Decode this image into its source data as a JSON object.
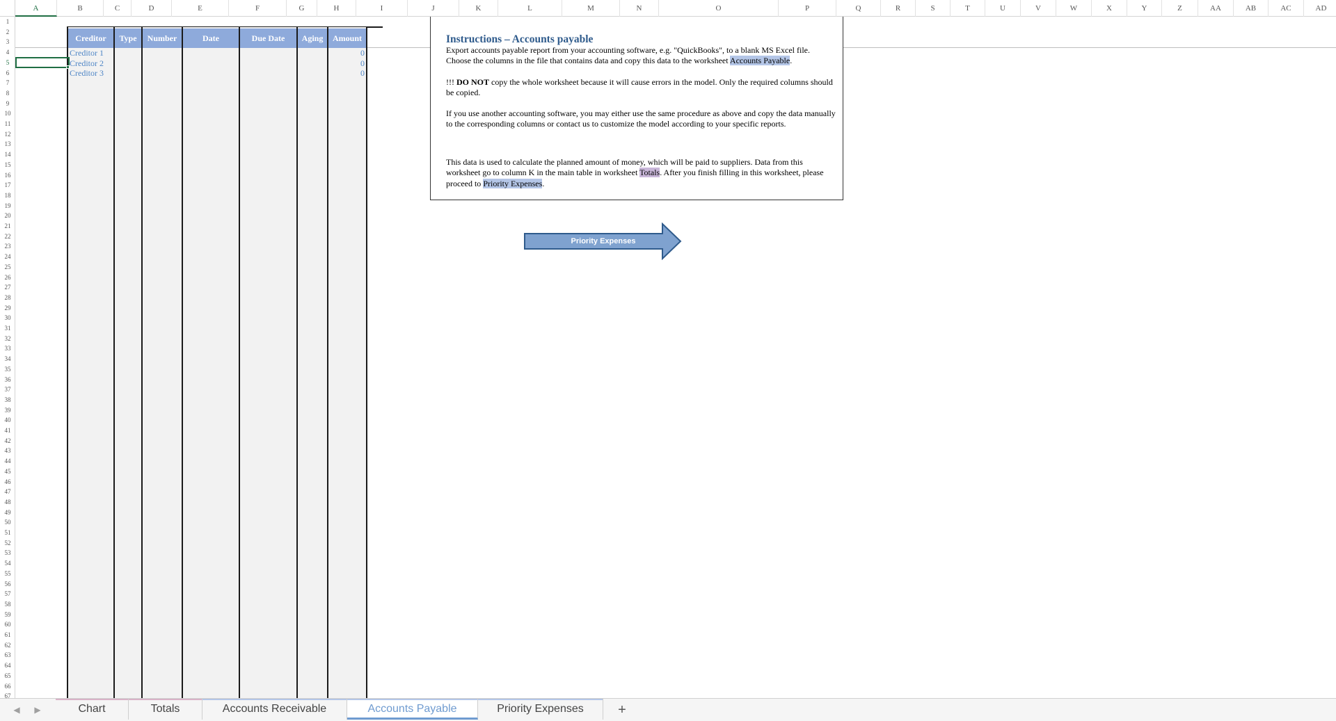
{
  "columns": [
    "A",
    "B",
    "C",
    "D",
    "E",
    "F",
    "G",
    "H",
    "I",
    "J",
    "K",
    "L",
    "M",
    "N",
    "O",
    "P",
    "Q",
    "R",
    "S",
    "T",
    "U",
    "V",
    "W",
    "X",
    "Y",
    "Z",
    "AA",
    "AB",
    "AC",
    "AD"
  ],
  "active_column": "A",
  "rows_visible": 67,
  "active_row": 5,
  "table": {
    "headers": [
      "Creditor",
      "Type",
      "Number",
      "Date",
      "Due Date",
      "Aging",
      "Amount"
    ],
    "rows": [
      {
        "creditor": "Creditor 1",
        "amount": "0"
      },
      {
        "creditor": "Creditor 2",
        "amount": "0"
      },
      {
        "creditor": "Creditor 3",
        "amount": "0"
      }
    ],
    "text_color": "#4f86c6",
    "header_color": "#8eaadb"
  },
  "instructions": {
    "title": "Instructions – Accounts payable",
    "p1_pre": "Export accounts payable report from your accounting software, e.g. \"QuickBooks\", to a blank MS Excel file. Choose the columns in the file that contains data and copy this data to the worksheet ",
    "p1_link": "Accounts Payable",
    "p1_post": ".",
    "p2_prefix": "!!! ",
    "p2_bold": "DO NOT",
    "p2_rest": " copy the whole worksheet because it will cause errors in the model. Only the required columns should be copied.",
    "p3": "If you use another accounting software, you may either use the same procedure as above and copy the data manually to the corresponding columns or contact us to customize the model according to your specific reports.",
    "p4_pre": "This data is used to calculate the planned amount of money, which will be paid to suppliers. Data from this worksheet go to column K in the main table in worksheet ",
    "p4_link1": "Totals",
    "p4_mid": ". After you finish filling in this worksheet, please proceed to ",
    "p4_link2": "Priority Expenses",
    "p4_post": "."
  },
  "arrow_button": {
    "label": "Priority Expenses",
    "color": "#7fa2cf"
  },
  "sheet_tabs": [
    {
      "label": "Chart",
      "active": false,
      "stripe": "#d9b3c8"
    },
    {
      "label": "Totals",
      "active": false,
      "stripe": "#d9b3c8"
    },
    {
      "label": "Accounts Receivable",
      "active": false,
      "stripe": "#b4c6e7"
    },
    {
      "label": "Accounts Payable",
      "active": true,
      "stripe": "#b4c6e7"
    },
    {
      "label": "Priority Expenses",
      "active": false,
      "stripe": "#b4c6e7"
    }
  ],
  "add_sheet_label": "+"
}
